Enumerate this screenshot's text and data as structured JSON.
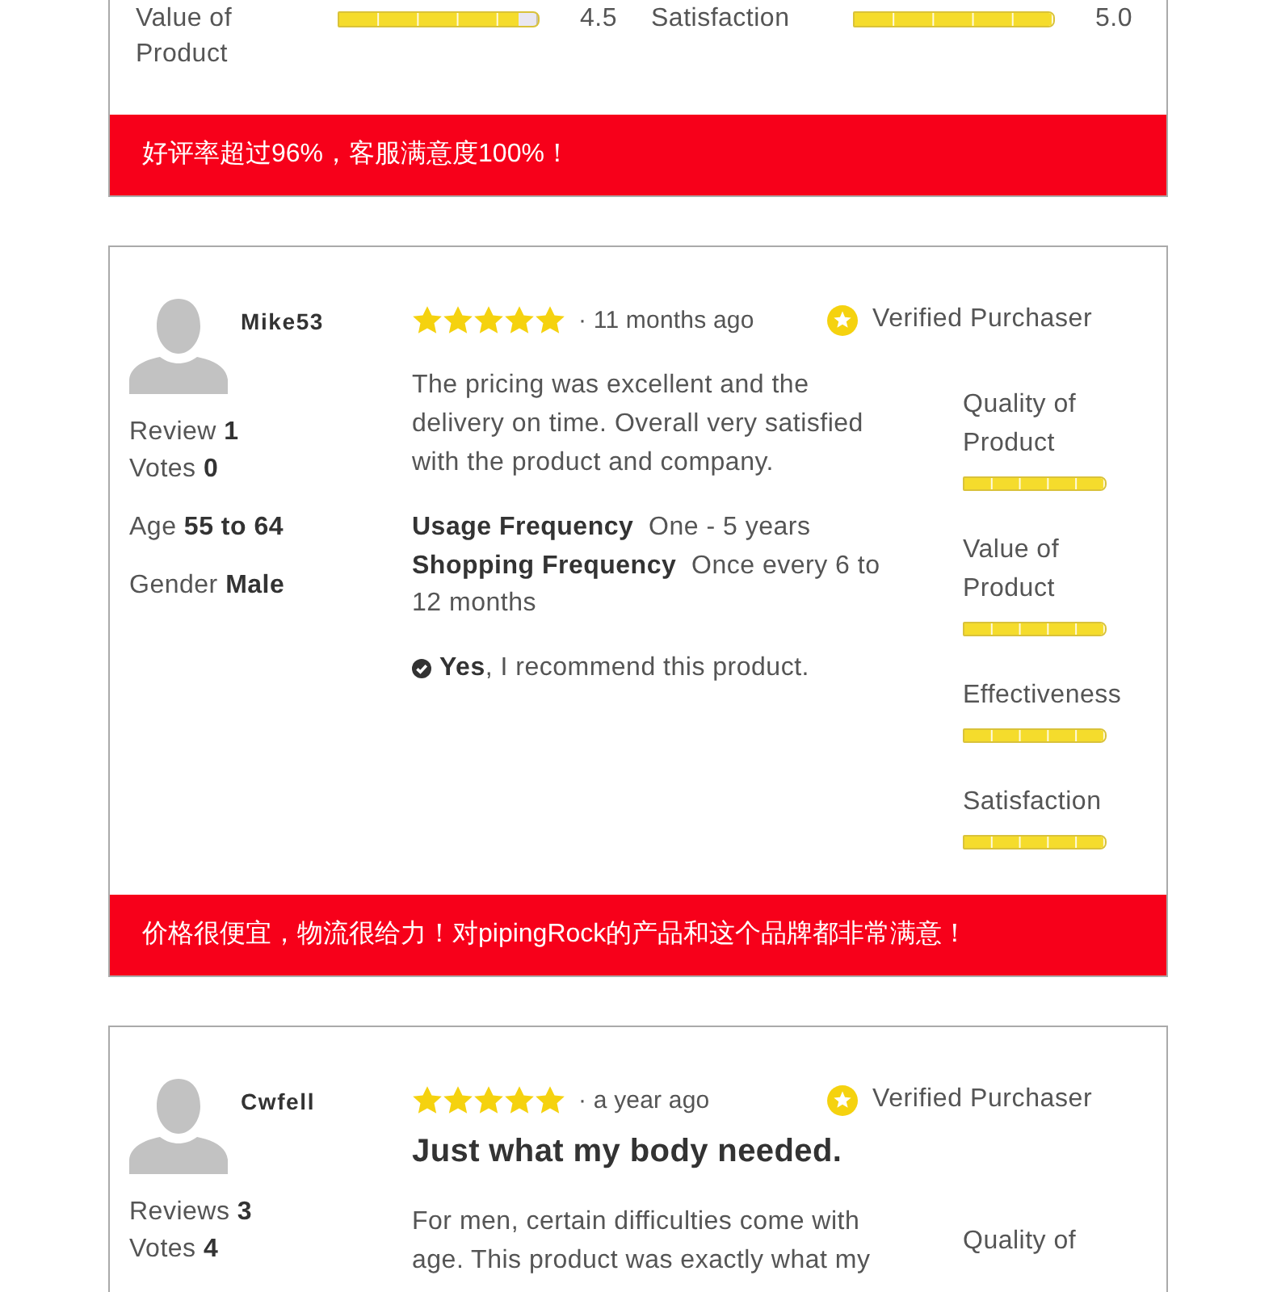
{
  "previous_review": {
    "ratings": [
      {
        "label": "Value of Product",
        "level": 0.9,
        "reading": "4.5"
      },
      {
        "label": "Satisfaction",
        "level": 1,
        "reading": "5.0"
      }
    ],
    "banner": "好评率超过96%，客服满意度100%！"
  },
  "reviews": [
    {
      "user": {
        "name": "Mike53",
        "stats": [
          {
            "label": "Review",
            "value": "1"
          },
          {
            "label": "Votes",
            "value": "0"
          }
        ],
        "demographics": [
          {
            "label": "Age",
            "value": "55 to 64"
          },
          {
            "label": "Gender",
            "value": "Male"
          }
        ]
      },
      "stars": 5,
      "time": "· 11 months ago",
      "verified": "Verified Purchaser",
      "body": "The pricing was excellent and the delivery on time. Overall very satisfied with the product and company.",
      "details": [
        {
          "label": "Usage Frequency",
          "value": "One - 5 years"
        },
        {
          "label": "Shopping Frequency",
          "value": "Once every 6 to 12 months"
        }
      ],
      "recommend": "**Yes**, I recommend this product.",
      "ratings": [
        {
          "label": "Quality of Product",
          "level": 1
        },
        {
          "label": "Value of Product",
          "level": 1
        },
        {
          "label": "Effectiveness",
          "level": 1
        },
        {
          "label": "Satisfaction",
          "level": 1
        }
      ],
      "banner": "价格很便宜，物流很给力！对pipingRock的产品和这个品牌都非常满意！"
    },
    {
      "user": {
        "name": "Cwfell",
        "stats": [
          {
            "label": "Reviews",
            "value": "3"
          },
          {
            "label": "Votes",
            "value": "4"
          }
        ]
      },
      "stars": 5,
      "time": "· a year ago",
      "verified": "Verified Purchaser",
      "title": "Just what my body needed.",
      "body": "For men, certain difficulties come with age. This product was exactly what my",
      "ratings": [
        {
          "label": "Quality of"
        }
      ]
    }
  ]
}
